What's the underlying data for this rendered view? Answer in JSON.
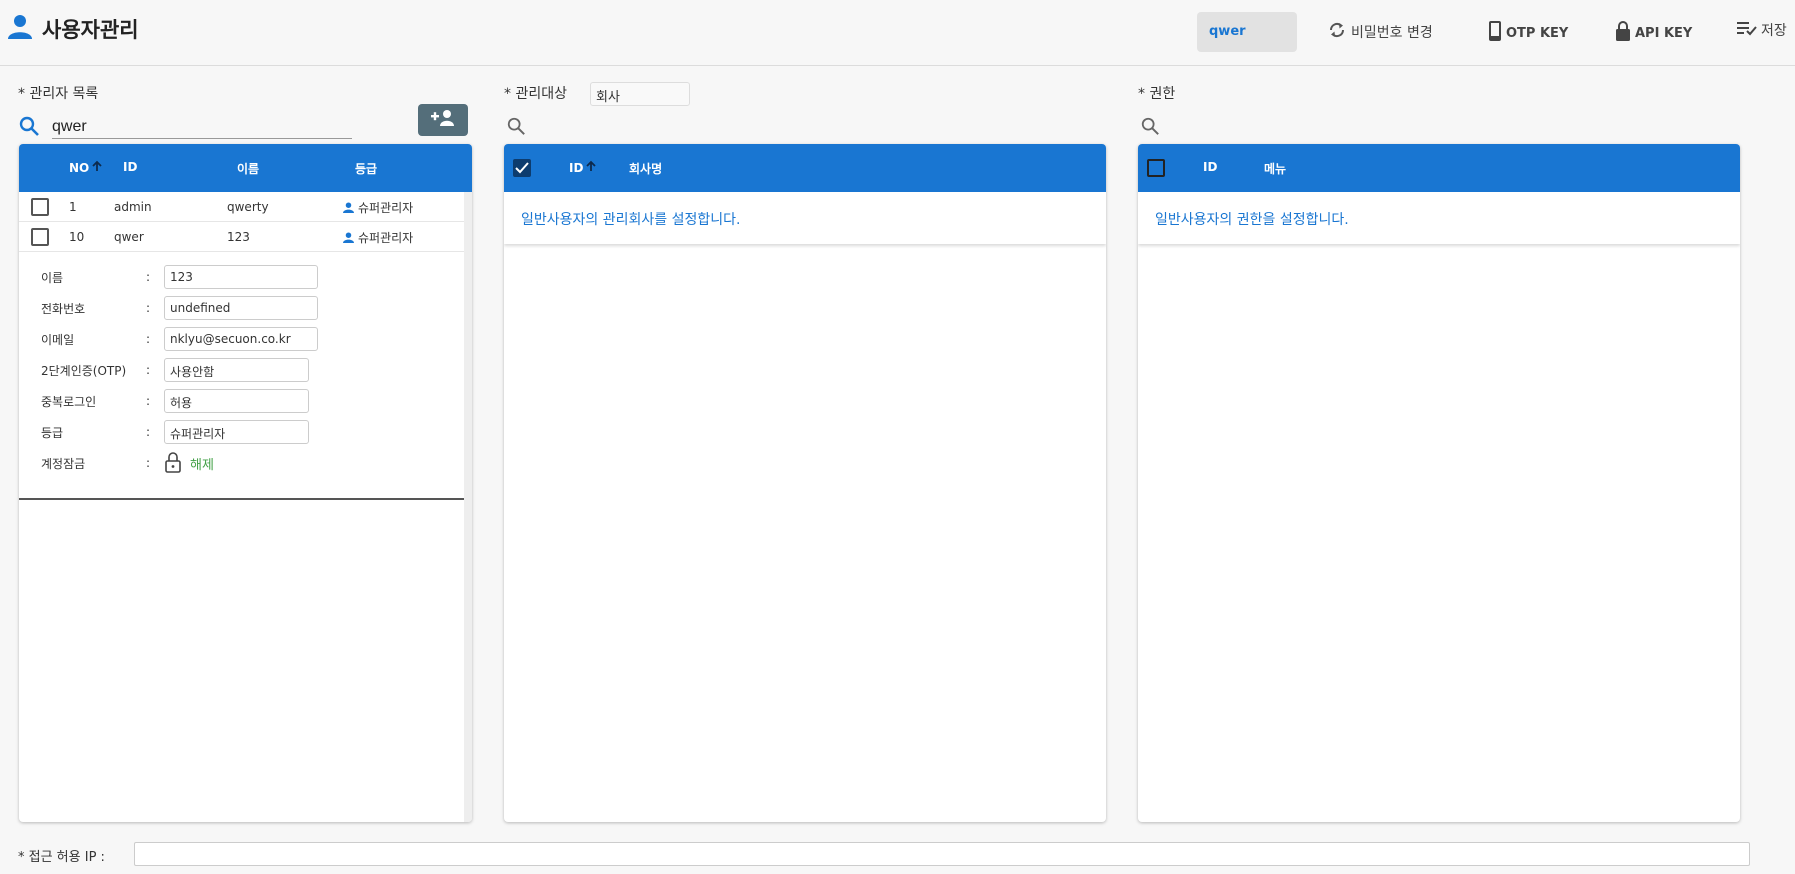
{
  "header": {
    "title": "사용자관리",
    "user_chip": "qwer",
    "actions": {
      "change_password": "비밀번호 변경",
      "otp_key": "OTP KEY",
      "api_key": "API KEY",
      "save": "저장"
    }
  },
  "admins": {
    "label": "* 관리자 목록",
    "search_value": "qwer",
    "columns": {
      "no": "NO",
      "id": "ID",
      "name": "이름",
      "grade": "등급"
    },
    "rows": [
      {
        "no": "1",
        "id": "admin",
        "name": "qwerty",
        "grade": "슈퍼관리자"
      },
      {
        "no": "10",
        "id": "qwer",
        "name": "123",
        "grade": "슈퍼관리자"
      }
    ],
    "detail": {
      "name_label": "이름",
      "name_value": "123",
      "phone_label": "전화번호",
      "phone_value": "undefined",
      "email_label": "이메일",
      "email_value": "nklyu@secuon.co.kr",
      "otp_label": "2단계인증(OTP)",
      "otp_value": "사용안함",
      "dup_label": "중복로그인",
      "dup_value": "허용",
      "grade_label": "등급",
      "grade_value": "슈퍼관리자",
      "lock_label": "계정잠금",
      "lock_value": "해제",
      "colon": ":"
    }
  },
  "targets": {
    "label": "* 관리대상",
    "select_value": "회사",
    "columns": {
      "id": "ID",
      "company": "회사명"
    },
    "empty_message": "일반사용자의 관리회사를 설정합니다."
  },
  "permissions": {
    "label": "* 권한",
    "columns": {
      "id": "ID",
      "menu": "메뉴"
    },
    "empty_message": "일반사용자의 권한을 설정합니다."
  },
  "footer": {
    "ip_label": "* 접근 허용 IP :"
  },
  "colors": {
    "primary": "#1976d2",
    "button": "#546e7a",
    "unlock": "#43a047"
  }
}
